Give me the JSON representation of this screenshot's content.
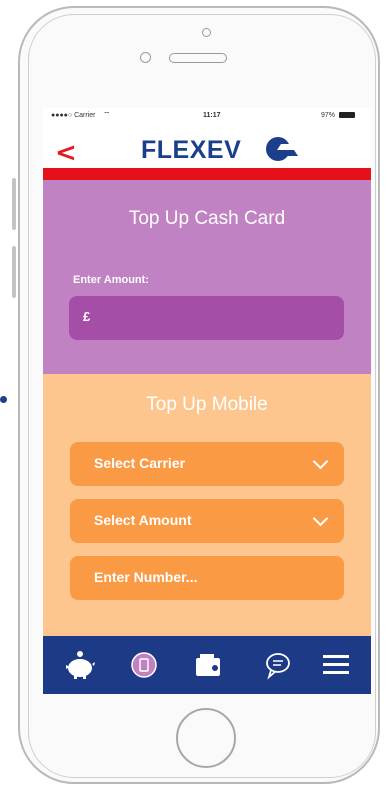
{
  "status_bar": {
    "carrier": "●●●●○ Carrier",
    "time": "11:17",
    "battery": "97%"
  },
  "header": {
    "back_label": "<",
    "logo_text": "FLEXEV"
  },
  "cash_card": {
    "title": "Top Up Cash Card",
    "amount_label": "Enter Amount:",
    "amount_value": "£"
  },
  "mobile_topup": {
    "title": "Top Up Mobile",
    "carrier_select": "Select Carrier",
    "amount_select": "Select Amount",
    "number_placeholder": "Enter Number..."
  },
  "tab_bar": {
    "items": [
      "piggy-bank-icon",
      "coin-icon",
      "wallet-icon",
      "chat-icon",
      "menu-icon"
    ]
  },
  "colors": {
    "brand_blue": "#1c3a85",
    "accent_red": "#e5101a",
    "cash_purple": "#c182c3",
    "cash_input": "#a44ea7",
    "mobile_orange": "#fdc68f",
    "mobile_pill": "#fb9a45"
  }
}
